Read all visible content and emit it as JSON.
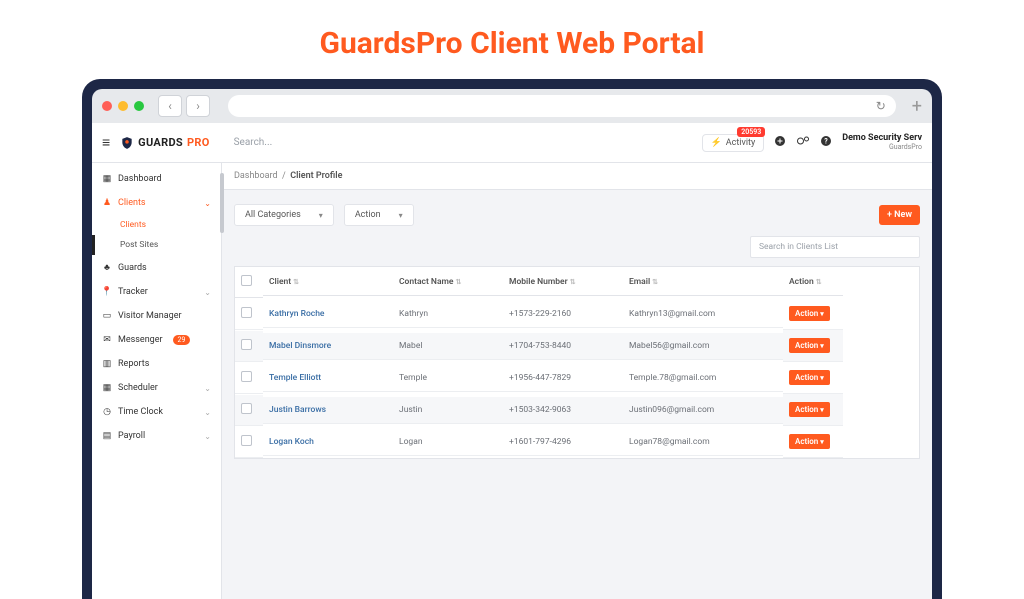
{
  "page_heading": "GuardsPro Client Web Portal",
  "logo": {
    "text_1": "GUARDS",
    "text_2": "PRO"
  },
  "topbar": {
    "search_placeholder": "Search...",
    "activity_label": "Activity",
    "activity_badge": "20593",
    "company_name": "Demo Security Serv",
    "company_sub": "GuardsPro"
  },
  "sidebar": {
    "dashboard": "Dashboard",
    "clients": "Clients",
    "clients_sub": "Clients",
    "post_sites": "Post Sites",
    "guards": "Guards",
    "tracker": "Tracker",
    "visitor": "Visitor Manager",
    "messenger": "Messenger",
    "messenger_badge": "29",
    "reports": "Reports",
    "scheduler": "Scheduler",
    "timeclock": "Time Clock",
    "payroll": "Payroll"
  },
  "breadcrumb": {
    "root": "Dashboard",
    "current": "Client Profile",
    "sep": "/"
  },
  "filters": {
    "categories": "All Categories",
    "action": "Action",
    "new_btn": "+ New"
  },
  "search_box_placeholder": "Search in Clients List",
  "columns": {
    "client": "Client",
    "contact": "Contact Name",
    "mobile": "Mobile Number",
    "email": "Email",
    "action": "Action"
  },
  "row_action_label": "Action",
  "rows": [
    {
      "client": "Kathryn Roche",
      "contact": "Kathryn",
      "mobile": "+1573-229-2160",
      "email": "Kathryn13@gmail.com"
    },
    {
      "client": "Mabel Dinsmore",
      "contact": "Mabel",
      "mobile": "+1704-753-8440",
      "email": "Mabel56@gmail.com"
    },
    {
      "client": "Temple Elliott",
      "contact": "Temple",
      "mobile": "+1956-447-7829",
      "email": "Temple.78@gmail.com"
    },
    {
      "client": "Justin Barrows",
      "contact": "Justin",
      "mobile": "+1503-342-9063",
      "email": "Justin096@gmail.com"
    },
    {
      "client": "Logan Koch",
      "contact": "Logan",
      "mobile": "+1601-797-4296",
      "email": "Logan78@gmail.com"
    }
  ]
}
